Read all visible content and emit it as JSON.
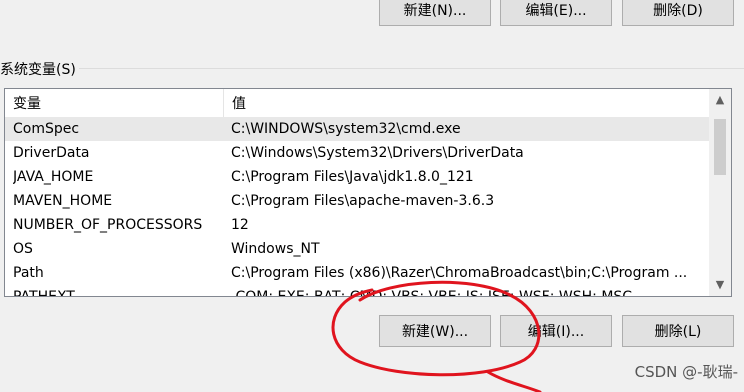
{
  "top_buttons": {
    "new": "新建(N)...",
    "edit": "编辑(E)...",
    "delete": "删除(D)"
  },
  "group_label": "系统变量(S)",
  "table": {
    "headers": [
      "变量",
      "值"
    ],
    "rows": [
      {
        "name": "ComSpec",
        "value": "C:\\WINDOWS\\system32\\cmd.exe"
      },
      {
        "name": "DriverData",
        "value": "C:\\Windows\\System32\\Drivers\\DriverData"
      },
      {
        "name": "JAVA_HOME",
        "value": "C:\\Program Files\\Java\\jdk1.8.0_121"
      },
      {
        "name": "MAVEN_HOME",
        "value": "C:\\Program Files\\apache-maven-3.6.3"
      },
      {
        "name": "NUMBER_OF_PROCESSORS",
        "value": "12"
      },
      {
        "name": "OS",
        "value": "Windows_NT"
      },
      {
        "name": "Path",
        "value": "C:\\Program Files (x86)\\Razer\\ChromaBroadcast\\bin;C:\\Program ..."
      },
      {
        "name": "PATHEXT",
        "value": ".COM;.EXE;.BAT;.CMD;.VBS;.VBE;.JS;.JSE;.WSF;.WSH;.MSC"
      }
    ]
  },
  "bottom_buttons": {
    "new": "新建(W)...",
    "edit": "编辑(I)...",
    "delete": "删除(L)"
  },
  "watermark": "CSDN @-耿瑞-",
  "colors": {
    "annotation": "#e0141e",
    "selected_row": "#e8e8e8"
  }
}
